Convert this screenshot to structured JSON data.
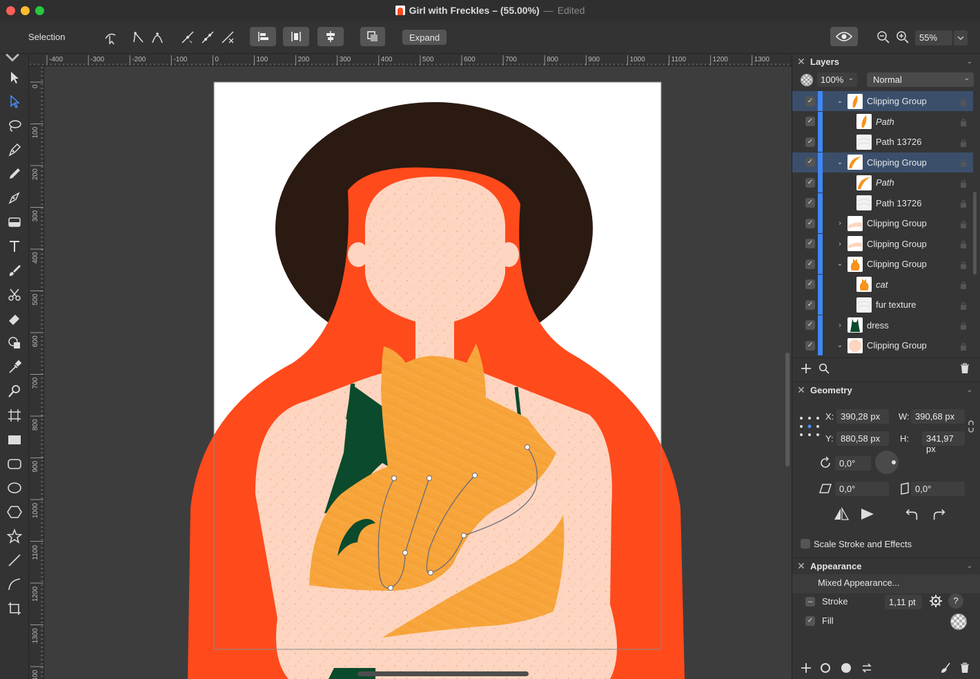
{
  "window": {
    "title": "Girl with Freckles – (55.00%)",
    "separator": "—",
    "status": "Edited"
  },
  "toolbar": {
    "mode_label": "Selection",
    "expand_label": "Expand",
    "zoom_value": "55%"
  },
  "rulers": {
    "unit": "px",
    "horizontal_ticks": [
      "-400",
      "-300",
      "-200",
      "-100",
      "0",
      "100",
      "200",
      "300",
      "400",
      "500",
      "600",
      "700",
      "800",
      "900",
      "1000",
      "1100",
      "1200",
      "1300"
    ],
    "vertical_ticks": [
      "0",
      "100",
      "200",
      "300",
      "400",
      "500",
      "600",
      "700",
      "800",
      "900",
      "1000",
      "1100",
      "1200",
      "1300",
      "1400"
    ]
  },
  "tools": [
    "direct-selection",
    "node",
    "lasso",
    "pen",
    "pencil",
    "vector-brush",
    "fill",
    "text",
    "brush",
    "scissors",
    "eraser",
    "shape-builder",
    "eyedropper",
    "zoom",
    "artboard",
    "rectangle",
    "rounded-rectangle",
    "ellipse",
    "polygon",
    "star",
    "line",
    "spiral",
    "crop"
  ],
  "layers_panel": {
    "title": "Layers",
    "opacity": "100%",
    "blend_mode": "Normal",
    "rows": [
      {
        "name": "Clipping Group",
        "indent": 1,
        "disclosure": "open",
        "selected": true,
        "italic": false,
        "thumb": "orange-leaf"
      },
      {
        "name": "Path",
        "indent": 2,
        "disclosure": "",
        "selected": false,
        "italic": true,
        "thumb": "orange-leaf"
      },
      {
        "name": "Path 13726",
        "indent": 2,
        "disclosure": "",
        "selected": false,
        "italic": false,
        "thumb": "texture"
      },
      {
        "name": "Clipping Group",
        "indent": 1,
        "disclosure": "open",
        "selected": true,
        "italic": false,
        "thumb": "orange-curve"
      },
      {
        "name": "Path",
        "indent": 2,
        "disclosure": "",
        "selected": false,
        "italic": true,
        "thumb": "orange-curve"
      },
      {
        "name": "Path 13726",
        "indent": 2,
        "disclosure": "",
        "selected": false,
        "italic": false,
        "thumb": "texture"
      },
      {
        "name": "Clipping Group",
        "indent": 1,
        "disclosure": "closed",
        "selected": false,
        "italic": false,
        "thumb": "skin-stroke"
      },
      {
        "name": "Clipping Group",
        "indent": 1,
        "disclosure": "closed",
        "selected": false,
        "italic": false,
        "thumb": "skin-stroke"
      },
      {
        "name": "Clipping Group",
        "indent": 1,
        "disclosure": "open",
        "selected": false,
        "italic": false,
        "thumb": "cat"
      },
      {
        "name": "cat",
        "indent": 2,
        "disclosure": "",
        "selected": false,
        "italic": true,
        "thumb": "cat"
      },
      {
        "name": "fur texture",
        "indent": 2,
        "disclosure": "",
        "selected": false,
        "italic": false,
        "thumb": "texture"
      },
      {
        "name": "dress",
        "indent": 1,
        "disclosure": "closed",
        "selected": false,
        "italic": false,
        "thumb": "dress"
      },
      {
        "name": "Clipping Group",
        "indent": 1,
        "disclosure": "open",
        "selected": false,
        "italic": false,
        "thumb": "skin"
      }
    ]
  },
  "geometry_panel": {
    "title": "Geometry",
    "x_label": "X:",
    "x_value": "390,28 px",
    "y_label": "Y:",
    "y_value": "880,58 px",
    "w_label": "W:",
    "w_value": "390,68 px",
    "h_label": "H:",
    "h_value": "341,97 px",
    "rotation": "0,0°",
    "shear": "0,0°",
    "skew": "0,0°",
    "scale_stroke_label": "Scale Stroke and Effects",
    "scale_stroke_checked": false
  },
  "appearance_panel": {
    "title": "Appearance",
    "summary": "Mixed Appearance...",
    "stroke_label": "Stroke",
    "stroke_width": "1,11 pt",
    "stroke_enabled": false,
    "fill_label": "Fill",
    "fill_enabled": true,
    "help_label": "?"
  },
  "colors": {
    "hair": "#ff4a1c",
    "halo": "#2a1a12",
    "skin": "#fdd5c0",
    "cat": "#f7a43a",
    "dress": "#0b4a2c",
    "selection_accent": "#3f87f5"
  }
}
